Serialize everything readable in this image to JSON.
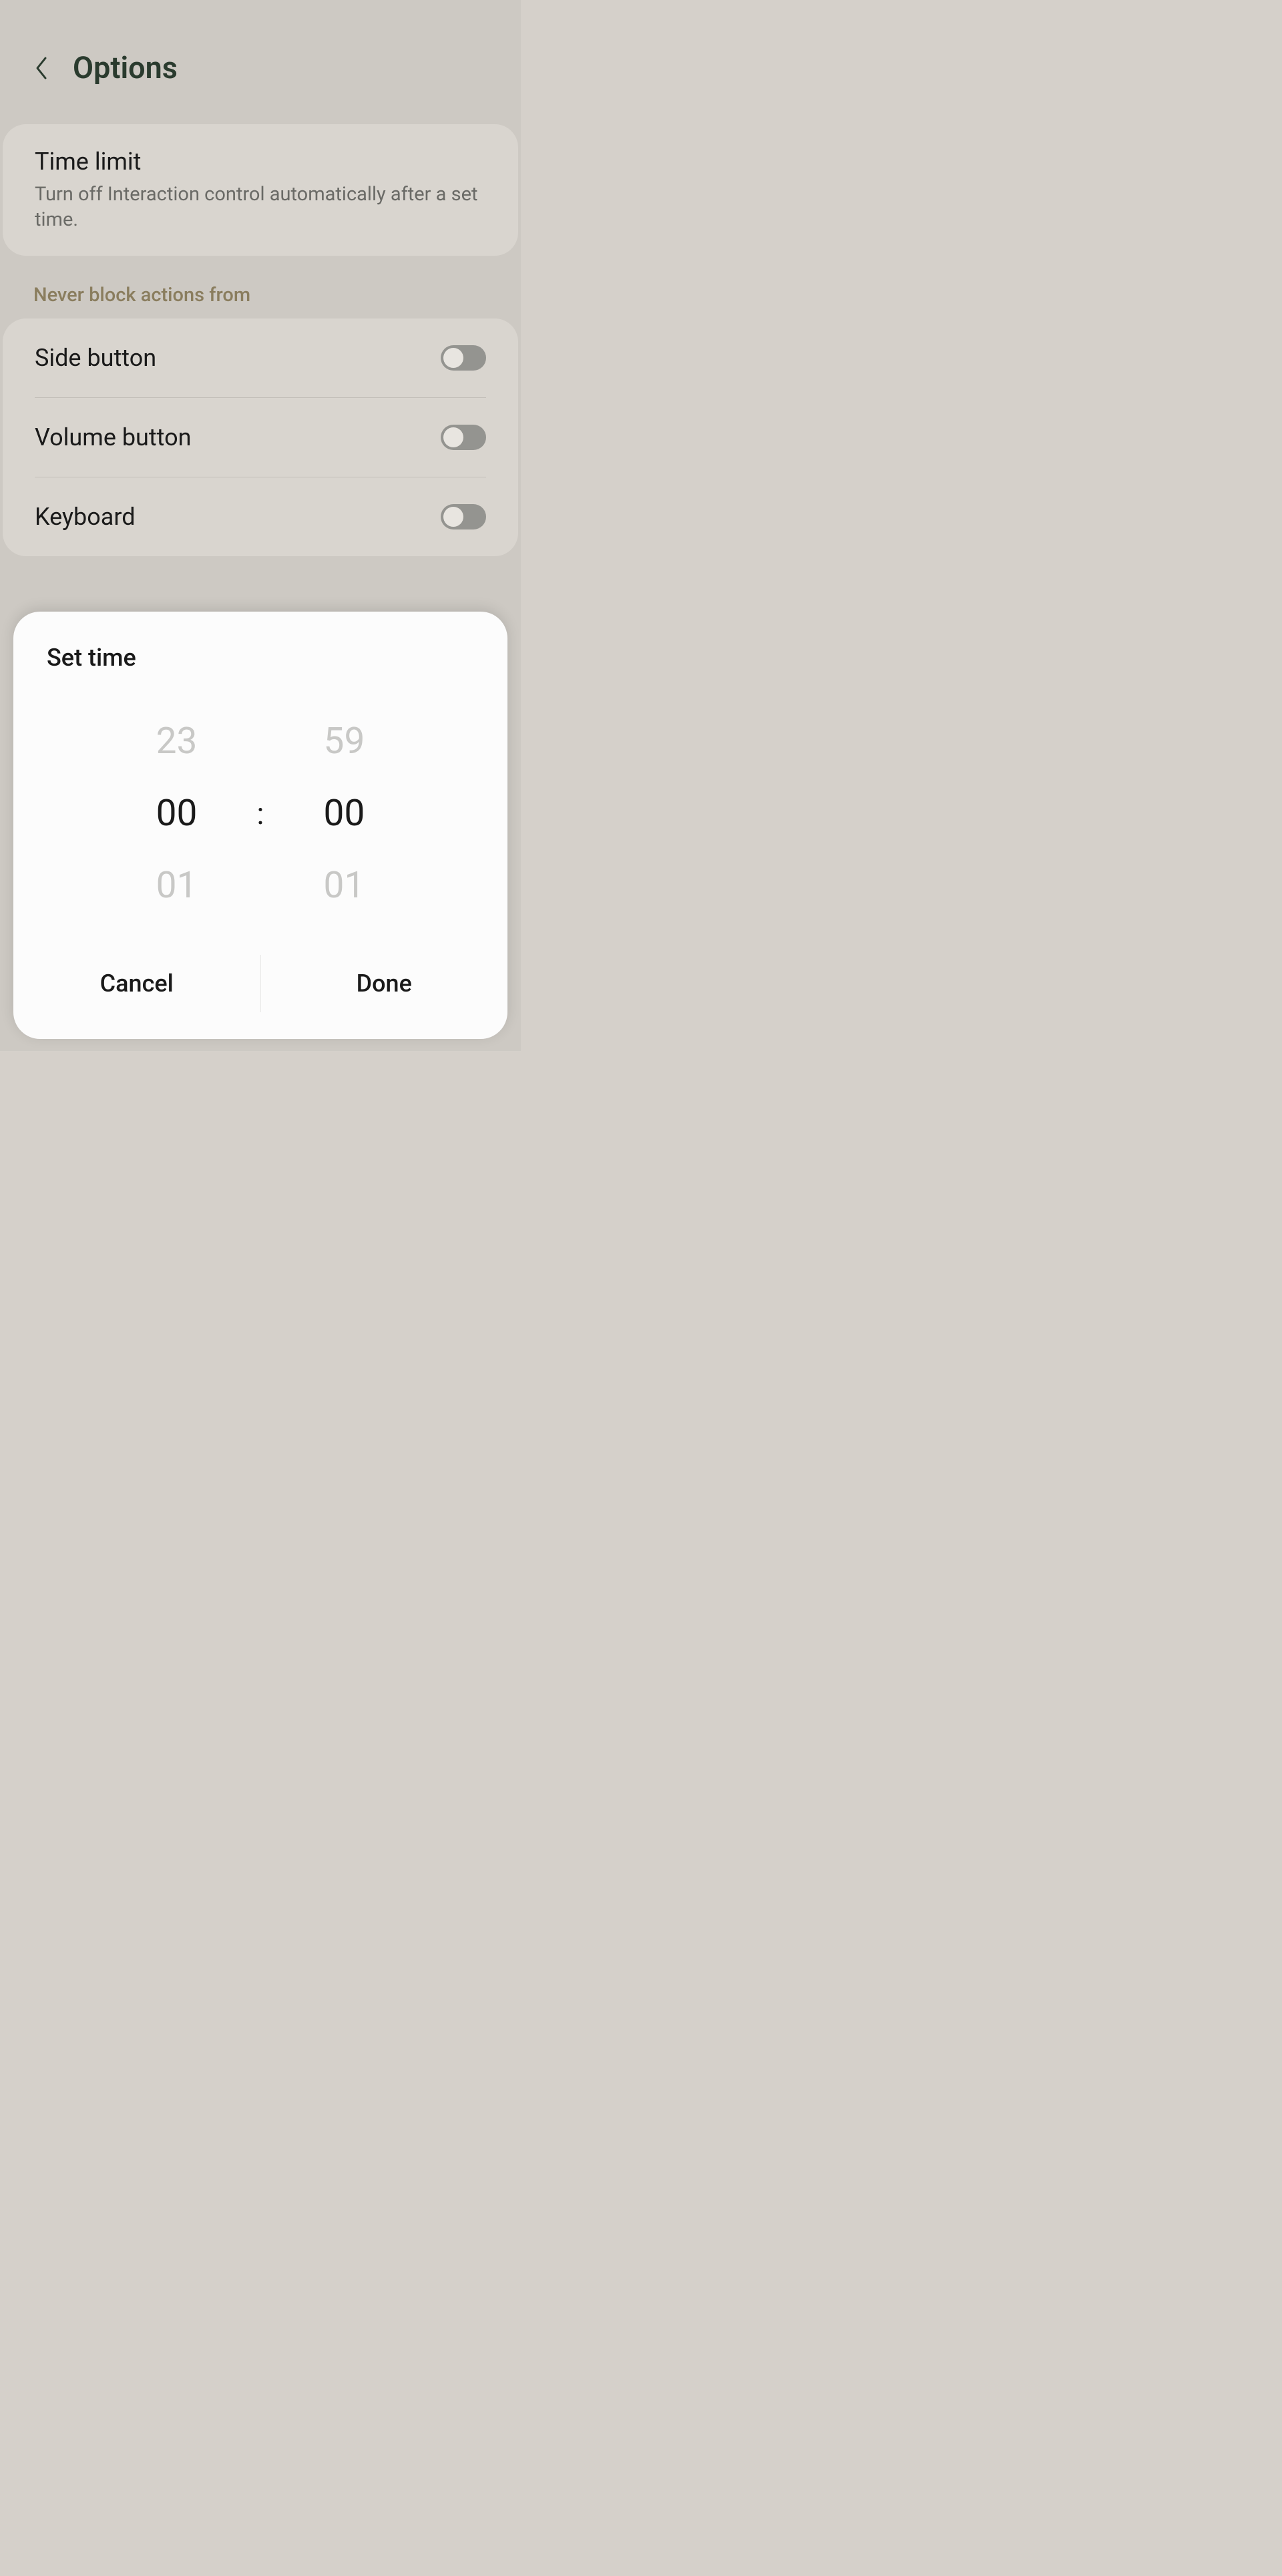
{
  "header": {
    "title": "Options"
  },
  "timeLimit": {
    "title": "Time limit",
    "subtitle": "Turn off Interaction control automatically after a set time."
  },
  "sectionLabel": "Never block actions from",
  "toggles": [
    {
      "label": "Side button",
      "state": false
    },
    {
      "label": "Volume button",
      "state": false
    },
    {
      "label": "Keyboard",
      "state": false
    }
  ],
  "dialog": {
    "title": "Set time",
    "hoursPicker": {
      "above": "23",
      "selected": "00",
      "below": "01"
    },
    "separator": ":",
    "minutesPicker": {
      "above": "59",
      "selected": "00",
      "below": "01"
    },
    "buttons": {
      "cancel": "Cancel",
      "done": "Done"
    }
  }
}
